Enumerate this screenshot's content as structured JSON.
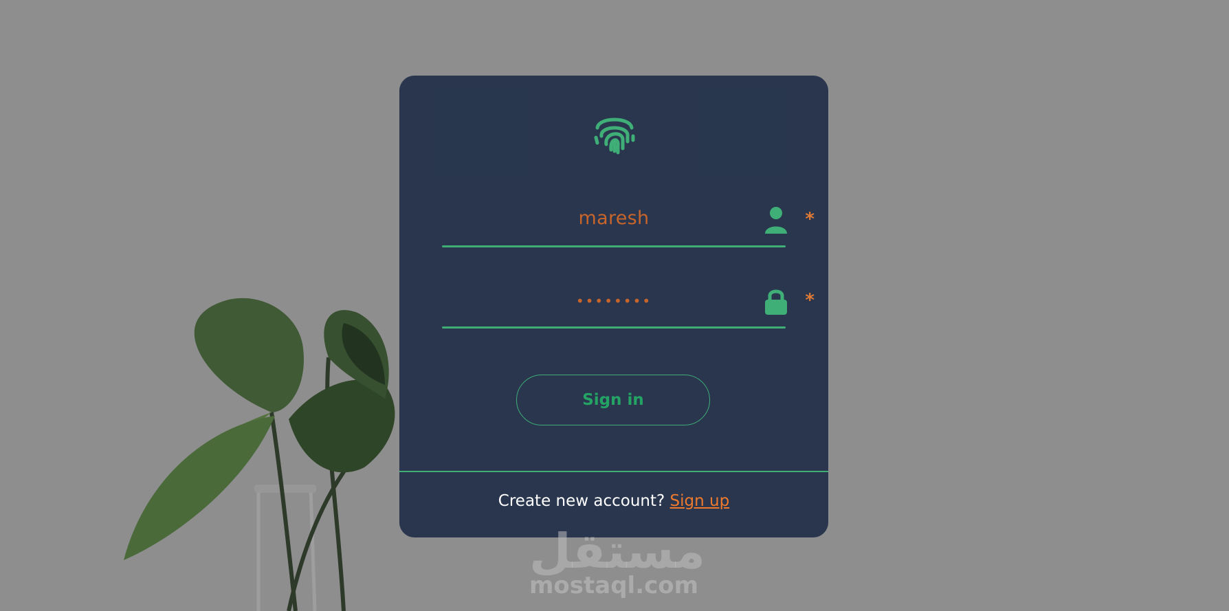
{
  "form": {
    "username_value": "maresh",
    "password_value": "••••••••",
    "required_marker": "*",
    "signin_label": "Sign in"
  },
  "footer": {
    "prompt_text": "Create new account?",
    "signup_link": "Sign up"
  },
  "watermark": {
    "arabic_text": "مستقل",
    "site_text": "mostaql.com"
  },
  "icons": {
    "logo": "fingerprint-icon",
    "username": "user-icon",
    "password": "lock-icon"
  },
  "colors": {
    "card_bg": "#24324b",
    "accent_green": "#3fae77",
    "button_text": "#24a365",
    "input_text": "#c8652a",
    "link_orange": "#ef7a2e",
    "page_bg": "#8e8e8e"
  }
}
